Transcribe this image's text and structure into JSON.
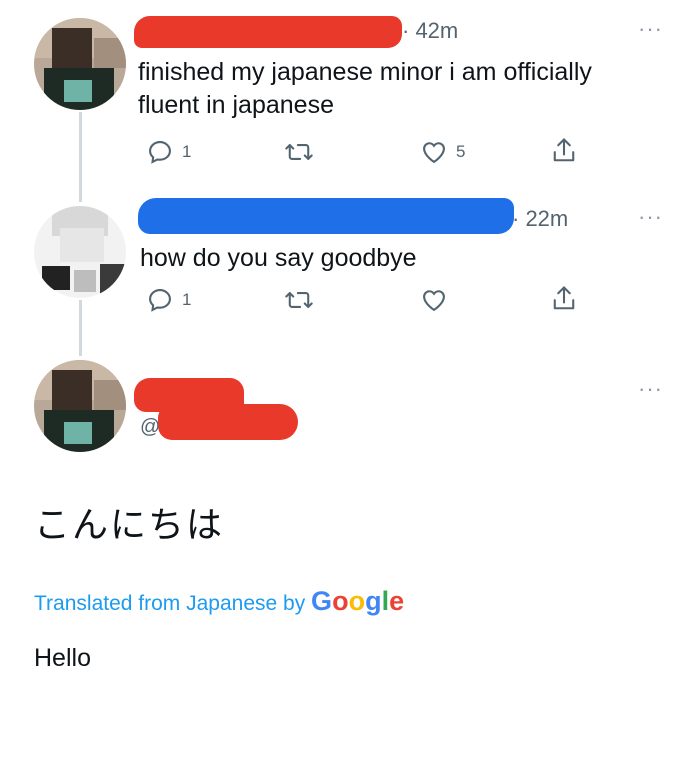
{
  "tweets": [
    {
      "time": "· 42m",
      "text": "finished my japanese minor i am officially\nfluent in japanese",
      "more": "···",
      "reply_count": "1",
      "like_count": "5"
    },
    {
      "time": "· 22m",
      "text": "how do you say goodbye",
      "more": "···",
      "reply_count": "1"
    },
    {
      "more": "···",
      "handle_partial": "@",
      "japanese_text": "こんにちは",
      "translation_label": "Translated from Japanese by",
      "translation_provider": "Google",
      "translation_text": "Hello"
    }
  ],
  "colors": {
    "red_redaction": "#e8392b",
    "blue_redaction": "#1f6fe8",
    "link_blue": "#1d9bf0",
    "icon_gray": "#536471"
  },
  "icons": [
    "reply-icon",
    "retweet-icon",
    "like-icon",
    "share-icon",
    "more-icon"
  ]
}
